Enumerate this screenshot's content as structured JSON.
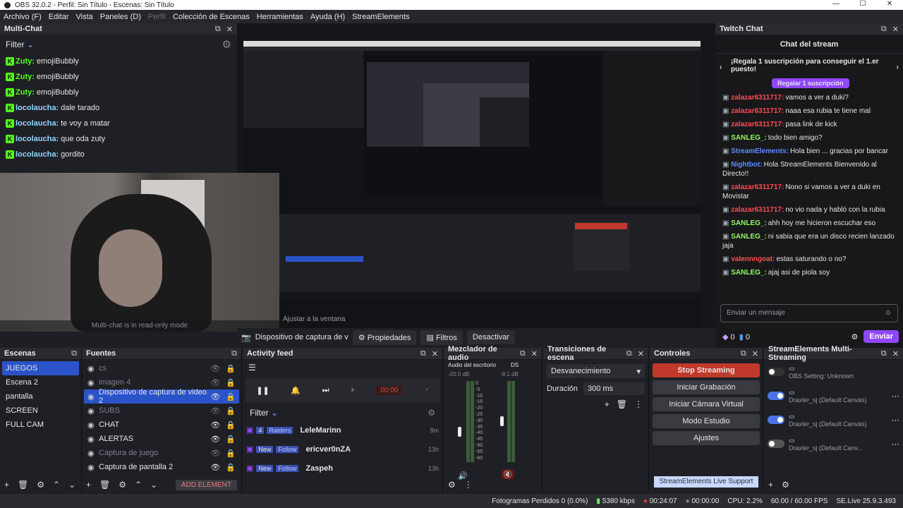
{
  "window": {
    "title": "OBS 32.0.2 - Perfil: Sin Título - Escenas: Sin Título"
  },
  "menu": [
    {
      "label": "Archivo (F)",
      "dim": false
    },
    {
      "label": "Editar",
      "dim": false
    },
    {
      "label": "Vista",
      "dim": false
    },
    {
      "label": "Paneles (D)",
      "dim": false
    },
    {
      "label": "Perfil",
      "dim": true
    },
    {
      "label": "Colección de Escenas",
      "dim": false
    },
    {
      "label": "Herramientas",
      "dim": false
    },
    {
      "label": "Ayuda (H)",
      "dim": false
    },
    {
      "label": "StreamElements",
      "dim": false
    }
  ],
  "multichat": {
    "title": "Multi-Chat",
    "filter": "Filter",
    "readonly": "Multi-chat is in read-only mode",
    "messages": [
      {
        "user": "Zuty:",
        "text": "emojiBubbly",
        "color": "#53fc18"
      },
      {
        "user": "Zuty:",
        "text": "emojiBubbly",
        "color": "#53fc18"
      },
      {
        "user": "Zuty:",
        "text": "emojiBubbly",
        "color": "#53fc18"
      },
      {
        "user": "locolaucha:",
        "text": "dale tarado",
        "color": "#8fd6ff"
      },
      {
        "user": "locolaucha:",
        "text": "te voy a matar",
        "color": "#8fd6ff"
      },
      {
        "user": "locolaucha:",
        "text": "que oda zuty",
        "color": "#8fd6ff"
      },
      {
        "user": "locolaucha:",
        "text": "gordito",
        "color": "#8fd6ff"
      }
    ]
  },
  "twitch": {
    "title": "Twitch Chat",
    "header": "Chat del stream",
    "promo": "¡Regala 1 suscripción para conseguir el 1.er puesto!",
    "gift": "Regalar 1 suscripción",
    "messages": [
      {
        "user": "zalazar6311717:",
        "text": "vamos a ver a duki?",
        "color": "#ff4d4d"
      },
      {
        "user": "zalazar6311717:",
        "text": "naaa esa rubia te tiene mal",
        "color": "#ff4d4d"
      },
      {
        "user": "zalazar6311717:",
        "text": "pasa link de kick",
        "color": "#ff4d4d"
      },
      {
        "user": "SANLEG_:",
        "text": "todo bien amigo?",
        "color": "#8cff5a"
      },
      {
        "user": "StreamElements:",
        "text": "Hola bien ... gracias por bancar",
        "color": "#5a8dff"
      },
      {
        "user": "Nightbot:",
        "text": "Hola StreamElements Bienvenido al Directo!!",
        "color": "#5a8dff"
      },
      {
        "user": "zalazar6311717:",
        "text": "Nono si vamos a ver a duki en Movistar",
        "color": "#ff4d4d"
      },
      {
        "user": "zalazar6311717:",
        "text": "no vio nada y habló con la rubia",
        "color": "#ff4d4d"
      },
      {
        "user": "SANLEG_:",
        "text": "ahh hoy me hicieron escuchar eso",
        "color": "#8cff5a"
      },
      {
        "user": "SANLEG_:",
        "text": "ni sabia que era un disco recien lanzado jaja",
        "color": "#8cff5a"
      },
      {
        "user": "valennngoat:",
        "text": "estas saturando o no?",
        "color": "#ff4d4d"
      },
      {
        "user": "SANLEG_:",
        "text": "ajaj asi de piola soy",
        "color": "#8cff5a"
      }
    ],
    "input_placeholder": "Enviar un mensaje",
    "count_a": "0",
    "count_b": "0",
    "send": "Enviar"
  },
  "preview": {
    "fit_label": "Ajustar a la ventana"
  },
  "sourcebar": {
    "source": "Dispositivo de captura de v",
    "props": "Propiedades",
    "filters": "Filtros",
    "deactivate": "Desactivar"
  },
  "scenes": {
    "title": "Escenas",
    "items": [
      "JUEGOS",
      "Escena 2",
      "pantalla",
      "SCREEN",
      "FULL CAM"
    ]
  },
  "sources": {
    "title": "Fuentes",
    "add": "ADD ELEMENT",
    "items": [
      {
        "label": "cs",
        "dim": true
      },
      {
        "label": "imagen 4",
        "dim": true
      },
      {
        "label": "Dispositivo de captura de video 2",
        "dim": false,
        "sel": true
      },
      {
        "label": "SUBS",
        "dim": true
      },
      {
        "label": "CHAT",
        "dim": false
      },
      {
        "label": "ALERTAS",
        "dim": false
      },
      {
        "label": "Captura de juego",
        "dim": true
      },
      {
        "label": "Captura de pantalla 2",
        "dim": false
      }
    ]
  },
  "activity": {
    "title": "Activity feed",
    "filter": "Filter",
    "timer": "00:00",
    "items": [
      {
        "badge": "4",
        "type": "Raiders",
        "name": "LeleMarinn",
        "time": "8m"
      },
      {
        "badge": "New",
        "type": "Follow",
        "name": "ericver0nZA",
        "time": "13h"
      },
      {
        "badge": "New",
        "type": "Follow",
        "name": "Zaspeh",
        "time": "13h"
      }
    ]
  },
  "mixer": {
    "title": "Mezclador de audio",
    "ch1": "Audio del escritorio",
    "ch1_db": "-20.0 dB",
    "ch2": "DS",
    "ch2_db": "-9.1 dB",
    "ticks": [
      "0",
      "-5",
      "-10",
      "-15",
      "-20",
      "-25",
      "-30",
      "-35",
      "-40",
      "-45",
      "-50",
      "-55",
      "-60"
    ]
  },
  "transitions": {
    "title": "Transiciones de escena",
    "type": "Desvanecimiento",
    "duration_label": "Duración",
    "duration": "300 ms"
  },
  "controls": {
    "title": "Controles",
    "stop": "Stop Streaming",
    "record": "Iniciar Grabación",
    "vcam": "Iniciar Cámara Virtual",
    "studio": "Modo Estudio",
    "settings": "Ajustes"
  },
  "se": {
    "title": "StreamElements Multi-Streaming",
    "support": "StreamElements Live Support",
    "items": [
      {
        "label": "OBS Setting: Unknown",
        "toggle": "none"
      },
      {
        "label": "Draxler_sj (Default Canvas)",
        "toggle": "on"
      },
      {
        "label": "Draxler_sj (Default Canvas)",
        "toggle": "on"
      },
      {
        "label": "Draxler_sj (Default Canv...",
        "toggle": "off"
      }
    ]
  },
  "status": {
    "dropped": "Fotogramas Perdidos 0 (0.0%)",
    "kbps": "5380 kbps",
    "live_time": "00:24:07",
    "rec_time": "00:00:00",
    "cpu": "CPU: 2.2%",
    "fps": "60.00 / 60.00 FPS",
    "version": "SE.Live 25.9.3.493"
  },
  "colors": {
    "accent": "#2b53c9",
    "twitch": "#9147ff",
    "stop": "#c0392b",
    "kick": "#53fc18"
  }
}
